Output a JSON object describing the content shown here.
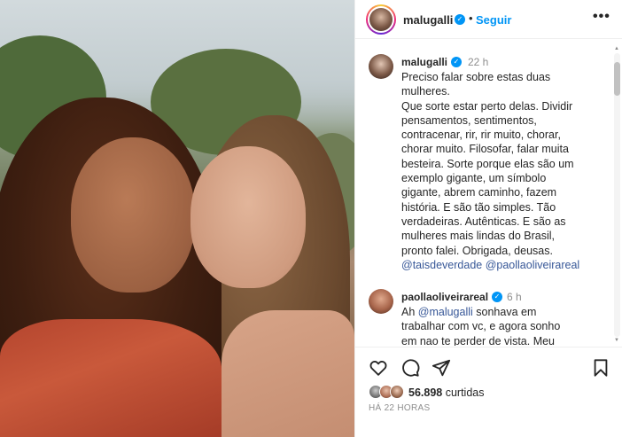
{
  "post": {
    "author": "malugalli",
    "follow_label": "Seguir",
    "separator": "•",
    "more_label": "•••",
    "verified_mark": "✓"
  },
  "caption": {
    "username": "malugalli",
    "time": "22 h",
    "lines": [
      "Preciso falar sobre estas duas",
      "mulheres.",
      "Que sorte estar perto delas. Dividir",
      "pensamentos, sentimentos,",
      "contracenar, rir, rir muito, chorar,",
      "chorar muito. Filosofar, falar muita",
      "besteira. Sorte porque elas são um",
      "exemplo gigante, um símbolo",
      "gigante, abrem caminho, fazem",
      "história. E são tão simples. Tão",
      "verdadeiras. Autênticas. E são as",
      "mulheres mais lindas do Brasil,",
      "pronto falei. Obrigada, deusas."
    ],
    "mentions": [
      "@taisdeverdade",
      "@paollaoliveirareal"
    ]
  },
  "comment": {
    "username": "paollaoliveirareal",
    "time": "6 h",
    "prefix": "Ah ",
    "mention": "@malugalli",
    "first_rest": " sonhava em",
    "lines": [
      "trabalhar com vc, e agora sonho",
      "em nao te perder de vista. Meu"
    ]
  },
  "actions": {
    "icons": [
      "heart-icon",
      "comment-icon",
      "share-icon",
      "bookmark-icon"
    ]
  },
  "likes": {
    "count": "56.898",
    "label": " curtidas"
  },
  "timestamp": "HÁ 22 HORAS"
}
